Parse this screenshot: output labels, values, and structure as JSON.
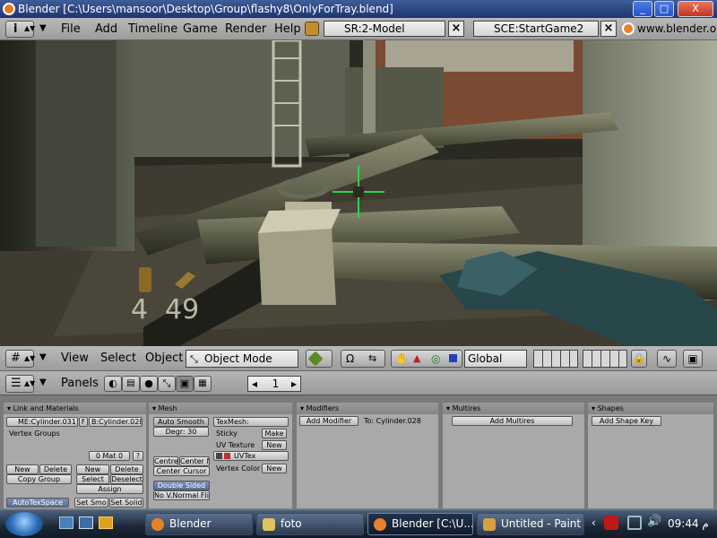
{
  "window": {
    "title": "Blender [C:\\Users\\mansoor\\Desktop\\Group\\flashy8\\OnlyForTray.blend]",
    "min": "_",
    "max": "□",
    "close": "X"
  },
  "topmenu": {
    "items": [
      "File",
      "Add",
      "Timeline",
      "Game",
      "Render",
      "Help"
    ],
    "screen": "SR:2-Model",
    "scene": "SCE:StartGame2",
    "site": "www.blender.or"
  },
  "hud": {
    "ammo": "4",
    "clip": "49"
  },
  "viewport_header": {
    "menus": [
      "View",
      "Select",
      "Object"
    ],
    "mode": "Object Mode",
    "orientation": "Global"
  },
  "buttons_header": {
    "panels_label": "Panels",
    "frame": "1"
  },
  "panels": {
    "link": {
      "title": "Link and Materials",
      "mesh_name": "ME:Cylinder.031",
      "f_label": "F",
      "object_name": "B:Cylinder.028",
      "vertex_groups": "Vertex Groups",
      "mat": "0 Mat 0",
      "mat_q": "?",
      "vg_new": "New",
      "vg_delete": "Delete",
      "vg_copy": "Copy Group",
      "mat_new": "New",
      "mat_delete": "Delete",
      "mat_select": "Select",
      "mat_deselect": "Deselect",
      "assign": "Assign",
      "autotexspace": "AutoTexSpace",
      "set_smooth": "Set Smo",
      "set_solid": "Set Solid"
    },
    "mesh": {
      "title": "Mesh",
      "auto_smooth": "Auto Smooth",
      "degr": "Degr: 30",
      "center_new": "Centre",
      "center_new2": "Center Ne",
      "center_cursor": "Center Cursor",
      "double_sided": "Double Sided",
      "no_vnormal": "No V.Normal Fli",
      "texmesh": "TexMesh:",
      "sticky": "Sticky",
      "make": "Make",
      "uv_texture": "UV Texture",
      "uv_new": "New",
      "uvtex": "UVTex",
      "vertex_color": "Vertex Color",
      "vc_new": "New"
    },
    "modifiers": {
      "title": "Modifiers",
      "add_modifier": "Add Modifier",
      "to": "To: Cylinder.028"
    },
    "multires": {
      "title": "Multires",
      "add_multires": "Add Multires"
    },
    "shapes": {
      "title": "Shapes",
      "add_shape_key": "Add Shape Key"
    }
  },
  "taskbar": {
    "items": [
      "Blender",
      "foto",
      "Blender [C:\\U...",
      "Untitled - Paint"
    ],
    "clock": "09:44 م"
  }
}
